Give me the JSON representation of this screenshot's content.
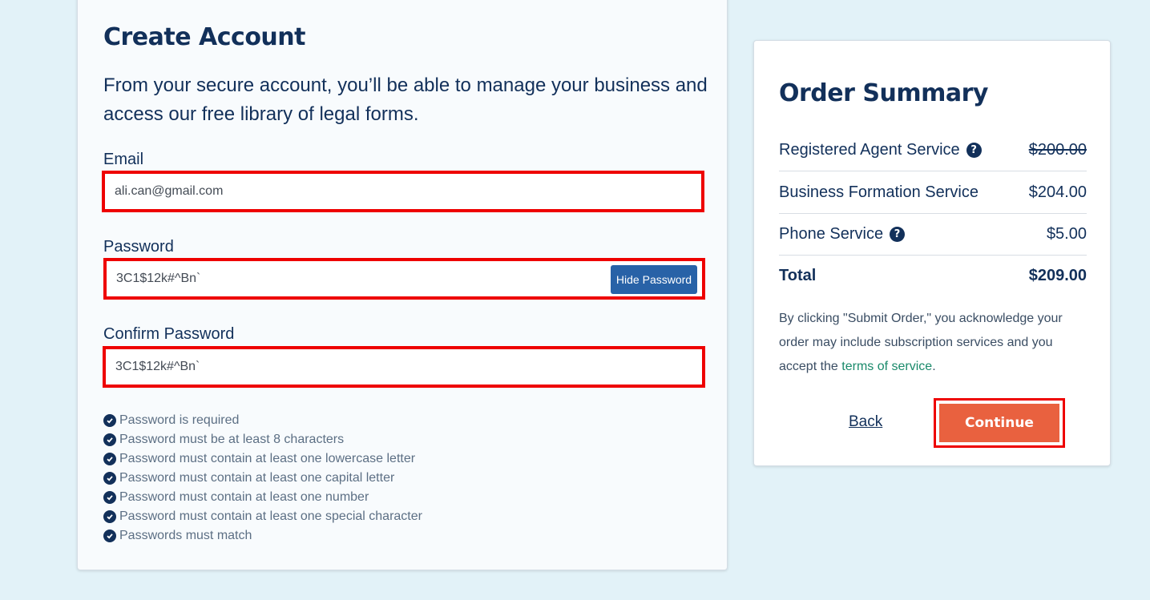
{
  "create_account": {
    "title": "Create Account",
    "intro": "From your secure account, you’ll be able to manage your business and access our free library of legal forms.",
    "email_label": "Email",
    "email_value": "ali.can@gmail.com",
    "password_label": "Password",
    "password_value": "3C1$12k#^Bn`",
    "hide_password_label": "Hide Password",
    "confirm_label": "Confirm Password",
    "confirm_value": "3C1$12k#^Bn`",
    "rules": [
      "Password is required",
      "Password must be at least 8 characters",
      "Password must contain at least one lowercase letter",
      "Password must contain at least one capital letter",
      "Password must contain at least one number",
      "Password must contain at least one special character",
      "Passwords must match"
    ]
  },
  "order_summary": {
    "title": "Order Summary",
    "items": [
      {
        "name": "Registered Agent Service",
        "price": "$200.00"
      },
      {
        "name": "Business Formation Service",
        "price": "$204.00"
      },
      {
        "name": "Phone Service",
        "price": "$5.00"
      }
    ],
    "total_label": "Total",
    "total_value": "$209.00",
    "disclaimer_prefix": "By clicking \"Submit Order,\" you acknowledge your order may include subscription services and you accept the ",
    "terms_link": "terms of service",
    "disclaimer_suffix": ".",
    "back_label": "Back",
    "continue_label": "Continue"
  },
  "colors": {
    "page_bg": "#e2f2f8",
    "navy": "#12305a",
    "accent_orange": "#e9613f",
    "button_blue": "#2862a7",
    "highlight_red": "#ee0000",
    "link_green": "#1a8a6b"
  },
  "icons": {
    "rule_check": "check-circle-icon",
    "help": "question-circle-icon"
  }
}
